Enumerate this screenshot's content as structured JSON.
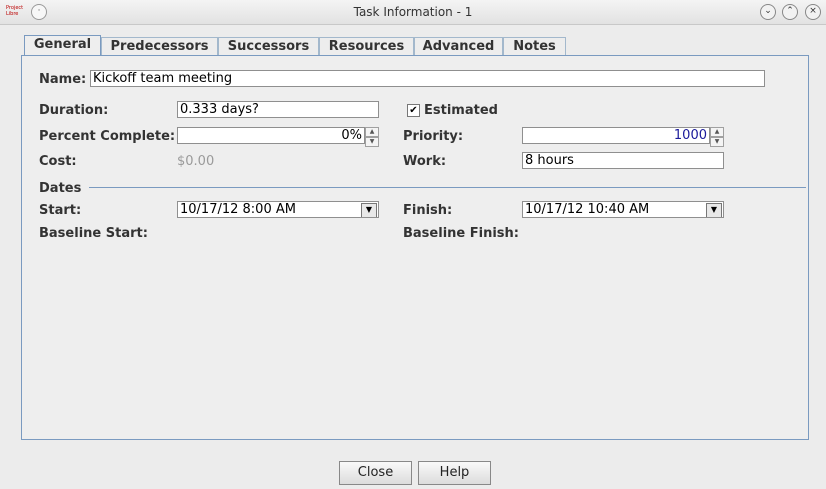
{
  "window": {
    "title": "Task Information - 1",
    "app_icon_text": "Project Libre"
  },
  "tabs": [
    "General",
    "Predecessors",
    "Successors",
    "Resources",
    "Advanced",
    "Notes"
  ],
  "general": {
    "name_label": "Name:",
    "name_value": "Kickoff team meeting",
    "duration_label": "Duration:",
    "duration_value": "0.333 days?",
    "estimated_label": "Estimated",
    "estimated_checked": true,
    "percent_label": "Percent Complete:",
    "percent_value": "0%",
    "priority_label": "Priority:",
    "priority_value": "1000",
    "cost_label": "Cost:",
    "cost_value": "$0.00",
    "work_label": "Work:",
    "work_value": "8 hours",
    "dates_label": "Dates",
    "start_label": "Start:",
    "start_value": "10/17/12 8:00 AM",
    "finish_label": "Finish:",
    "finish_value": "10/17/12 10:40 AM",
    "baseline_start_label": "Baseline Start:",
    "baseline_finish_label": "Baseline Finish:"
  },
  "buttons": {
    "close": "Close",
    "help": "Help"
  },
  "colors": {
    "accent": "#7a9ac0",
    "priority_text": "#1a1a9a",
    "disabled_text": "#9a9a9a"
  }
}
